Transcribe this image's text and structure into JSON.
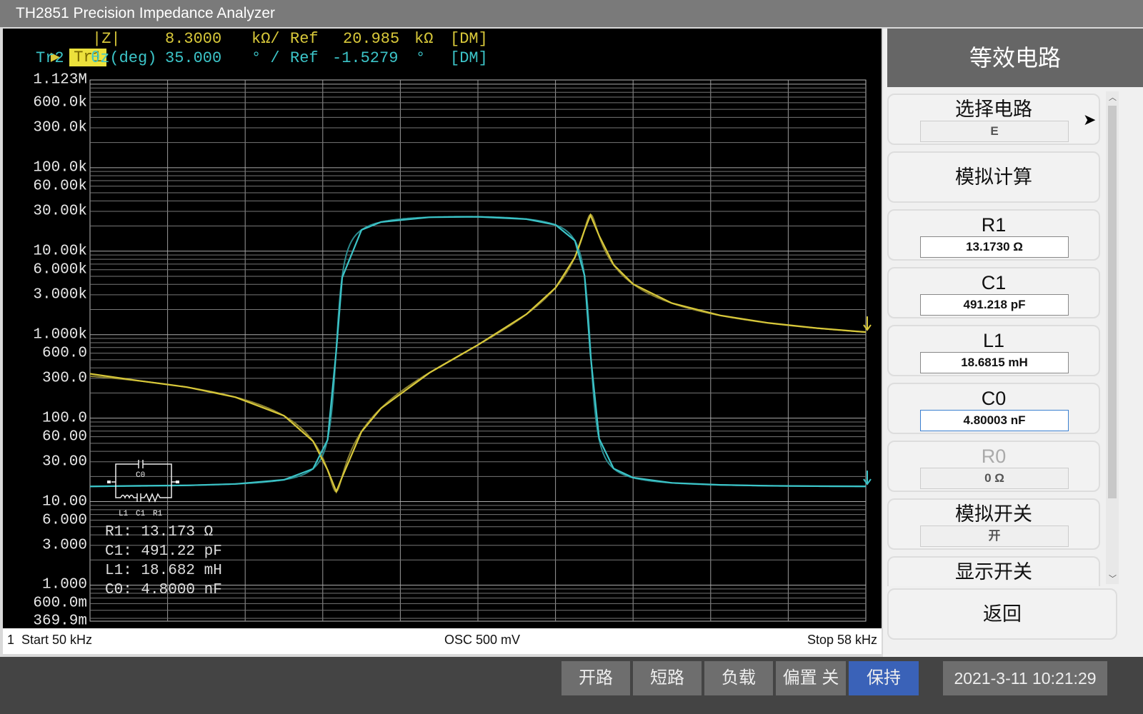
{
  "window": {
    "title": "TH2851 Precision Impedance Analyzer"
  },
  "traces": {
    "tr1": {
      "tag": "Tr1",
      "param": "|Z|",
      "scale": "8.3000",
      "unit": "kΩ/",
      "ref_label": "Ref",
      "ref": "20.985",
      "ref_unit": "kΩ",
      "mode": "[DM]"
    },
    "tr2": {
      "tag": "Tr2",
      "param": "θz(deg)",
      "scale": "35.000",
      "unit": "° /",
      "ref_label": "Ref",
      "ref": "-1.5279",
      "ref_unit": "°",
      "mode": "[DM]"
    }
  },
  "circuit": {
    "labels": {
      "c0": "C0",
      "l1": "L1",
      "c1": "C1",
      "r1": "R1"
    },
    "results": [
      "R1: 13.173 Ω",
      "C1: 491.22 pF",
      "L1: 18.682 mH",
      "C0: 4.8000 nF"
    ]
  },
  "footer": {
    "channel": "1",
    "start": "Start  50 kHz",
    "osc": "OSC 500 mV",
    "stop": "Stop  58 kHz"
  },
  "panel": {
    "title": "等效电路",
    "select": {
      "label": "选择电路",
      "value": "E"
    },
    "simulate": {
      "label": "模拟计算"
    },
    "r1": {
      "label": "R1",
      "value": "13.1730 Ω",
      "num": 13.173
    },
    "c1": {
      "label": "C1",
      "value": "491.218 pF",
      "num": 4.91218e-10
    },
    "l1": {
      "label": "L1",
      "value": "18.6815 mH",
      "num": 0.0186815
    },
    "c0": {
      "label": "C0",
      "value": "4.80003 nF",
      "num": 4.80003e-09
    },
    "r0": {
      "label": "R0",
      "value": "0 Ω"
    },
    "sim_switch": {
      "label": "模拟开关",
      "value": "开"
    },
    "display_switch": {
      "label": "显示开关"
    },
    "back": {
      "label": "返回"
    }
  },
  "statusbar": {
    "buttons": [
      "开路",
      "短路",
      "负载",
      "偏置 关",
      "保持"
    ],
    "datetime": "2021-3-11 10:21:29"
  },
  "colors": {
    "tr1": "#d8c83a",
    "tr2": "#3cc4c8",
    "active_button": "#3a62b8"
  },
  "chart_data": {
    "type": "line",
    "x_range_khz": [
      50,
      58
    ],
    "y1_scale": "log",
    "y1_range": [
      0.3699,
      1123000
    ],
    "y1_ticks": [
      "1.123M",
      "600.0k",
      "300.0k",
      "100.0k",
      "60.00k",
      "30.00k",
      "10.00k",
      "6.000k",
      "3.000k",
      "1.000k",
      "600.0",
      "300.0",
      "100.0",
      "60.00",
      "30.00",
      "10.00",
      "6.000",
      "3.000",
      "1.000",
      "600.0m",
      "369.9m"
    ],
    "y1_tick_values": [
      1123000,
      600000,
      300000,
      100000,
      60000,
      30000,
      10000,
      6000,
      3000,
      1000,
      600,
      300,
      100,
      60,
      30,
      10,
      6,
      3,
      1,
      0.6,
      0.3699
    ],
    "y2_ref_deg": -1.5279,
    "y2_div_deg": 35,
    "divisions": 10,
    "grid": true,
    "x_khz": [
      50,
      50.5,
      51,
      51.5,
      52,
      52.3,
      52.45,
      52.54,
      52.6,
      52.8,
      53,
      53.5,
      54,
      54.5,
      54.8,
      55,
      55.1,
      55.16,
      55.25,
      55.4,
      55.6,
      56,
      56.5,
      57,
      57.5,
      58
    ],
    "series": [
      {
        "name": "|Z|",
        "values": [
          340,
          281,
          235,
          178,
          107,
          53,
          24,
          13.2,
          19.7,
          69,
          131,
          349,
          753,
          1756,
          3640,
          8430,
          17900,
          27000,
          15300,
          6860,
          4040,
          2384,
          1697,
          1379,
          1195,
          1074
        ]
      },
      {
        "name": "θz(deg)",
        "values": [
          -89.4,
          -89.0,
          -88.7,
          -87.8,
          -85.1,
          -78,
          -59.3,
          -1.2,
          45.7,
          76.5,
          81.6,
          84.7,
          85,
          83.5,
          79.8,
          69.6,
          46.9,
          -3.9,
          -58.5,
          -77.8,
          -83.7,
          -87.1,
          -88.4,
          -89,
          -89.2,
          -89.3
        ]
      }
    ]
  }
}
